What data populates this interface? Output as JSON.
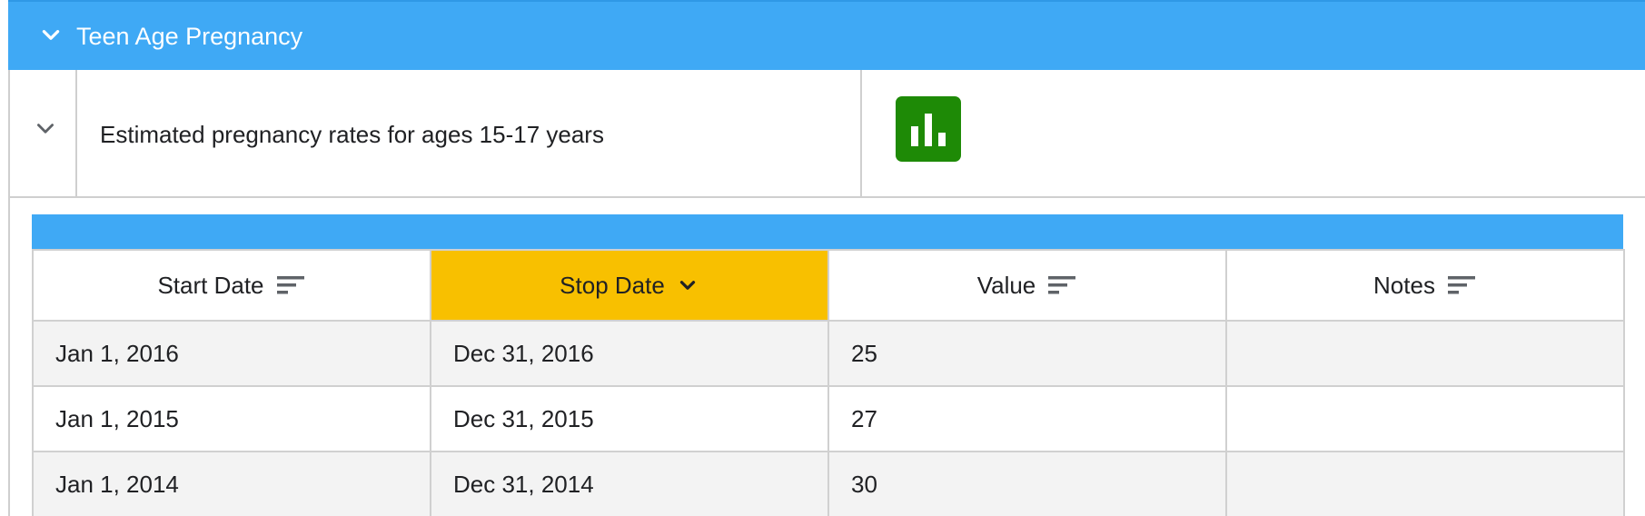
{
  "section": {
    "title": "Teen Age Pregnancy",
    "icon": "chevron-down-icon"
  },
  "indicator": {
    "label": "Estimated pregnancy rates for ages 15-17 years",
    "chart_button_icon": "bar-chart-icon",
    "chart_button_color": "#1e8a06"
  },
  "table": {
    "header_bar_color": "#3fa9f5",
    "columns": [
      {
        "label": "Start Date",
        "icon": "sort-lines-icon"
      },
      {
        "label": "Stop Date",
        "icon": "chevron-down-icon",
        "sorted": true,
        "highlight_color": "#f8c000"
      },
      {
        "label": "Value",
        "icon": "sort-lines-icon"
      },
      {
        "label": "Notes",
        "icon": "sort-lines-icon"
      }
    ],
    "rows": [
      {
        "start": "Jan 1, 2016",
        "stop": "Dec 31, 2016",
        "value": "25",
        "notes": ""
      },
      {
        "start": "Jan 1, 2015",
        "stop": "Dec 31, 2015",
        "value": "27",
        "notes": ""
      },
      {
        "start": "Jan 1, 2014",
        "stop": "Dec 31, 2014",
        "value": "30",
        "notes": ""
      }
    ]
  },
  "colors": {
    "accent": "#3fa9f5",
    "row_alt": "#f3f3f3",
    "border": "#d0d0d0"
  }
}
